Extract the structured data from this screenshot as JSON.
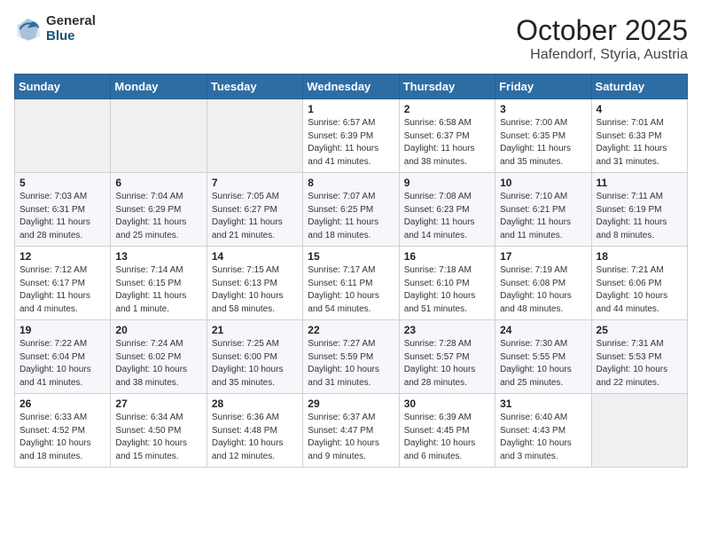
{
  "logo": {
    "general": "General",
    "blue": "Blue"
  },
  "header": {
    "month": "October 2025",
    "location": "Hafendorf, Styria, Austria"
  },
  "weekdays": [
    "Sunday",
    "Monday",
    "Tuesday",
    "Wednesday",
    "Thursday",
    "Friday",
    "Saturday"
  ],
  "weeks": [
    [
      {
        "day": "",
        "sunrise": "",
        "sunset": "",
        "daylight": ""
      },
      {
        "day": "",
        "sunrise": "",
        "sunset": "",
        "daylight": ""
      },
      {
        "day": "",
        "sunrise": "",
        "sunset": "",
        "daylight": ""
      },
      {
        "day": "1",
        "sunrise": "Sunrise: 6:57 AM",
        "sunset": "Sunset: 6:39 PM",
        "daylight": "Daylight: 11 hours and 41 minutes."
      },
      {
        "day": "2",
        "sunrise": "Sunrise: 6:58 AM",
        "sunset": "Sunset: 6:37 PM",
        "daylight": "Daylight: 11 hours and 38 minutes."
      },
      {
        "day": "3",
        "sunrise": "Sunrise: 7:00 AM",
        "sunset": "Sunset: 6:35 PM",
        "daylight": "Daylight: 11 hours and 35 minutes."
      },
      {
        "day": "4",
        "sunrise": "Sunrise: 7:01 AM",
        "sunset": "Sunset: 6:33 PM",
        "daylight": "Daylight: 11 hours and 31 minutes."
      }
    ],
    [
      {
        "day": "5",
        "sunrise": "Sunrise: 7:03 AM",
        "sunset": "Sunset: 6:31 PM",
        "daylight": "Daylight: 11 hours and 28 minutes."
      },
      {
        "day": "6",
        "sunrise": "Sunrise: 7:04 AM",
        "sunset": "Sunset: 6:29 PM",
        "daylight": "Daylight: 11 hours and 25 minutes."
      },
      {
        "day": "7",
        "sunrise": "Sunrise: 7:05 AM",
        "sunset": "Sunset: 6:27 PM",
        "daylight": "Daylight: 11 hours and 21 minutes."
      },
      {
        "day": "8",
        "sunrise": "Sunrise: 7:07 AM",
        "sunset": "Sunset: 6:25 PM",
        "daylight": "Daylight: 11 hours and 18 minutes."
      },
      {
        "day": "9",
        "sunrise": "Sunrise: 7:08 AM",
        "sunset": "Sunset: 6:23 PM",
        "daylight": "Daylight: 11 hours and 14 minutes."
      },
      {
        "day": "10",
        "sunrise": "Sunrise: 7:10 AM",
        "sunset": "Sunset: 6:21 PM",
        "daylight": "Daylight: 11 hours and 11 minutes."
      },
      {
        "day": "11",
        "sunrise": "Sunrise: 7:11 AM",
        "sunset": "Sunset: 6:19 PM",
        "daylight": "Daylight: 11 hours and 8 minutes."
      }
    ],
    [
      {
        "day": "12",
        "sunrise": "Sunrise: 7:12 AM",
        "sunset": "Sunset: 6:17 PM",
        "daylight": "Daylight: 11 hours and 4 minutes."
      },
      {
        "day": "13",
        "sunrise": "Sunrise: 7:14 AM",
        "sunset": "Sunset: 6:15 PM",
        "daylight": "Daylight: 11 hours and 1 minute."
      },
      {
        "day": "14",
        "sunrise": "Sunrise: 7:15 AM",
        "sunset": "Sunset: 6:13 PM",
        "daylight": "Daylight: 10 hours and 58 minutes."
      },
      {
        "day": "15",
        "sunrise": "Sunrise: 7:17 AM",
        "sunset": "Sunset: 6:11 PM",
        "daylight": "Daylight: 10 hours and 54 minutes."
      },
      {
        "day": "16",
        "sunrise": "Sunrise: 7:18 AM",
        "sunset": "Sunset: 6:10 PM",
        "daylight": "Daylight: 10 hours and 51 minutes."
      },
      {
        "day": "17",
        "sunrise": "Sunrise: 7:19 AM",
        "sunset": "Sunset: 6:08 PM",
        "daylight": "Daylight: 10 hours and 48 minutes."
      },
      {
        "day": "18",
        "sunrise": "Sunrise: 7:21 AM",
        "sunset": "Sunset: 6:06 PM",
        "daylight": "Daylight: 10 hours and 44 minutes."
      }
    ],
    [
      {
        "day": "19",
        "sunrise": "Sunrise: 7:22 AM",
        "sunset": "Sunset: 6:04 PM",
        "daylight": "Daylight: 10 hours and 41 minutes."
      },
      {
        "day": "20",
        "sunrise": "Sunrise: 7:24 AM",
        "sunset": "Sunset: 6:02 PM",
        "daylight": "Daylight: 10 hours and 38 minutes."
      },
      {
        "day": "21",
        "sunrise": "Sunrise: 7:25 AM",
        "sunset": "Sunset: 6:00 PM",
        "daylight": "Daylight: 10 hours and 35 minutes."
      },
      {
        "day": "22",
        "sunrise": "Sunrise: 7:27 AM",
        "sunset": "Sunset: 5:59 PM",
        "daylight": "Daylight: 10 hours and 31 minutes."
      },
      {
        "day": "23",
        "sunrise": "Sunrise: 7:28 AM",
        "sunset": "Sunset: 5:57 PM",
        "daylight": "Daylight: 10 hours and 28 minutes."
      },
      {
        "day": "24",
        "sunrise": "Sunrise: 7:30 AM",
        "sunset": "Sunset: 5:55 PM",
        "daylight": "Daylight: 10 hours and 25 minutes."
      },
      {
        "day": "25",
        "sunrise": "Sunrise: 7:31 AM",
        "sunset": "Sunset: 5:53 PM",
        "daylight": "Daylight: 10 hours and 22 minutes."
      }
    ],
    [
      {
        "day": "26",
        "sunrise": "Sunrise: 6:33 AM",
        "sunset": "Sunset: 4:52 PM",
        "daylight": "Daylight: 10 hours and 18 minutes."
      },
      {
        "day": "27",
        "sunrise": "Sunrise: 6:34 AM",
        "sunset": "Sunset: 4:50 PM",
        "daylight": "Daylight: 10 hours and 15 minutes."
      },
      {
        "day": "28",
        "sunrise": "Sunrise: 6:36 AM",
        "sunset": "Sunset: 4:48 PM",
        "daylight": "Daylight: 10 hours and 12 minutes."
      },
      {
        "day": "29",
        "sunrise": "Sunrise: 6:37 AM",
        "sunset": "Sunset: 4:47 PM",
        "daylight": "Daylight: 10 hours and 9 minutes."
      },
      {
        "day": "30",
        "sunrise": "Sunrise: 6:39 AM",
        "sunset": "Sunset: 4:45 PM",
        "daylight": "Daylight: 10 hours and 6 minutes."
      },
      {
        "day": "31",
        "sunrise": "Sunrise: 6:40 AM",
        "sunset": "Sunset: 4:43 PM",
        "daylight": "Daylight: 10 hours and 3 minutes."
      },
      {
        "day": "",
        "sunrise": "",
        "sunset": "",
        "daylight": ""
      }
    ]
  ]
}
